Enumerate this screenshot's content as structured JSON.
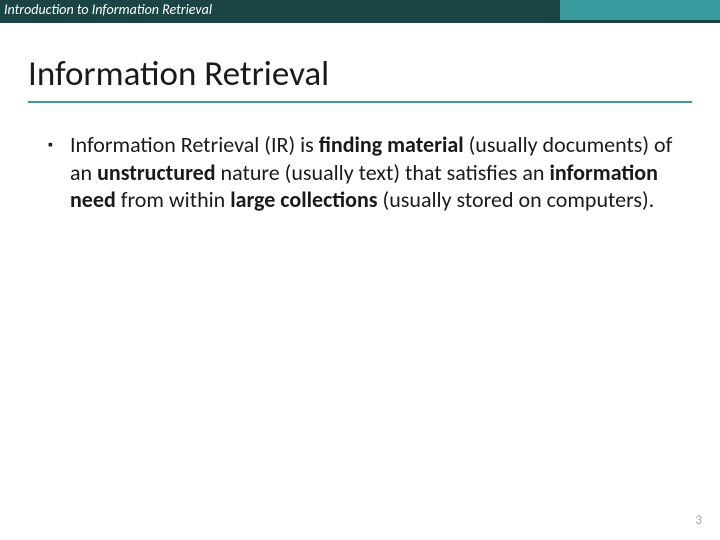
{
  "header": {
    "course": "Introduction to Information Retrieval"
  },
  "slide": {
    "title": "Information Retrieval",
    "bullet": {
      "seg1": "Information Retrieval (IR) is ",
      "seg2_bold": "finding material",
      "seg3": " (usually documents) of an ",
      "seg4_bold": "unstructured",
      "seg5": " nature (usually text) that satisfies an ",
      "seg6_bold": "information need",
      "seg7": " from within ",
      "seg8_bold": "large collections",
      "seg9": " (usually stored on computers)."
    }
  },
  "page_number": "3"
}
